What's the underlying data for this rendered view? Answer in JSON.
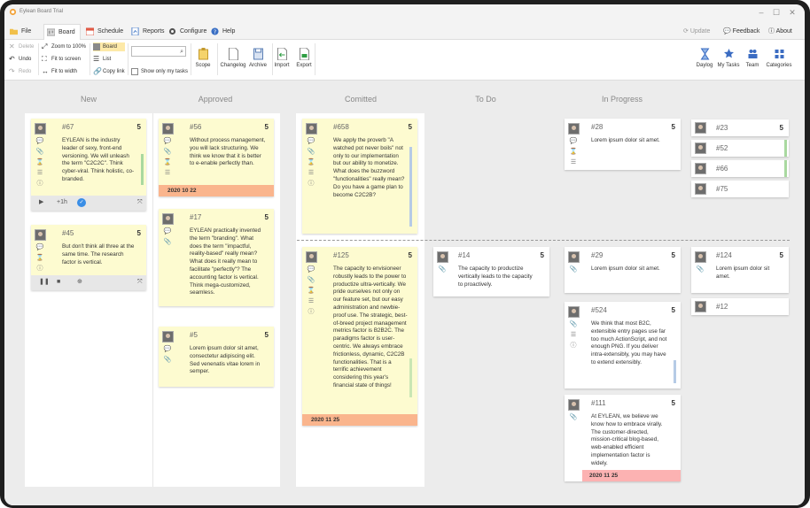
{
  "window": {
    "title": "Eylean Board Trial",
    "controls": {
      "minimize": "–",
      "maximize": "☐",
      "close": "✕"
    }
  },
  "menu": {
    "tabs": [
      {
        "label": "File"
      },
      {
        "label": "Board"
      },
      {
        "label": "Schedule"
      },
      {
        "label": "Reports"
      },
      {
        "label": "Configure"
      },
      {
        "label": "Help"
      }
    ],
    "right": {
      "update": "Update",
      "feedback": "Feedback",
      "about": "About"
    }
  },
  "ribbon": {
    "delete": "Delete",
    "undo": "Undo",
    "redo": "Redo",
    "zoom_100": "Zoom to 100%",
    "fit_screen": "Fit to screen",
    "fit_width": "Fit to width",
    "board": "Board",
    "list": "List",
    "copy_link": "Copy link",
    "search_placeholder": "",
    "show_only_my_tasks": "Show only my tasks",
    "scope": "Scope",
    "changelog": "Changelog",
    "archive": "Archive",
    "import": "Import",
    "export": "Export",
    "daylog": "Daylog",
    "my_tasks": "My Tasks",
    "team": "Team",
    "categories": "Categories"
  },
  "columns": {
    "new": "New",
    "approved": "Approved",
    "comitted": "Comitted",
    "todo": "To Do",
    "in_progress": "In Progress"
  },
  "cards": {
    "c67": {
      "id": "#67",
      "pts": "5",
      "text": "EYLEAN is the industry leader of sexy, front-end versioning. We will unleash the term \"C2C2C\". Think cyber-viral. Think holistic, co-branded.",
      "time": "+1h"
    },
    "c45": {
      "id": "#45",
      "pts": "5",
      "text": "But don't think all three at the same time. The research factor is vertical."
    },
    "c56": {
      "id": "#56",
      "pts": "5",
      "text": "Without process management, you will lack structuring. We think we know that it is better to e-enable perfectly than.",
      "due": "2020 10 22"
    },
    "c17": {
      "id": "#17",
      "pts": "5",
      "text": "EYLEAN practically invented the term \"branding\". What does the term \"impactful, reality-based\" really mean? What does it really mean to facilitate \"perfectly\"? The accounting factor is vertical. Think mega-customized, seamless."
    },
    "c5": {
      "id": "#5",
      "pts": "5",
      "text": "Lorem ipsum dolor sit amet, consectetur adipiscing elit. Sed venenatis vitae lorem in semper."
    },
    "c658": {
      "id": "#658",
      "pts": "5",
      "text": "We apply the proverb \"A watched pot never boils\" not only to our implementation but our ability to monetize. What does the buzzword \"functionalities\" really mean? Do you have a game plan to become C2C2B?"
    },
    "c125": {
      "id": "#125",
      "pts": "5",
      "text": "The capacity to envisioneer robustly leads to the power to productize ultra-vertically. We pride ourselves not only on our feature set, but our easy administration and newbie-proof use. The strategic, best-of-breed project management metrics factor is B2B2C. The paradigms factor is user-centric. We always embrace frictionless, dynamic, C2C2B functionalities. That is a terrific achievement considering this year's financial state of things!",
      "due": "2020 11 25"
    },
    "c14": {
      "id": "#14",
      "pts": "5",
      "text": "The capacity to productize vertically leads to the capacity to proactively."
    },
    "c28": {
      "id": "#28",
      "pts": "5",
      "text": "Lorem ipsum dolor sit amet."
    },
    "c29": {
      "id": "#29",
      "pts": "5",
      "text": "Lorem ipsum dolor sit amet."
    },
    "c524": {
      "id": "#524",
      "pts": "5",
      "text": "We think that most B2C, extensible entry pages use far too much ActionScript, and not enough PNG. If you deliver intra-extensibly, you may have to extend extensibly."
    },
    "c111": {
      "id": "#111",
      "pts": "5",
      "text": "At EYLEAN, we believe we know how to embrace virally. The customer-directed, mission-critical blog-based, web-enabled efficient implementation factor is widely.",
      "due": "2020 11 25"
    },
    "c23": {
      "id": "#23",
      "pts": "5"
    },
    "c52": {
      "id": "#52"
    },
    "c66": {
      "id": "#66"
    },
    "c75": {
      "id": "#75"
    },
    "c124": {
      "id": "#124",
      "pts": "5",
      "text": "Lorem ipsum dolor sit amet."
    },
    "c12": {
      "id": "#12"
    }
  },
  "colors": {
    "sticky_yellow": "#fdfbd0",
    "due_orange": "#fab58d",
    "due_pink": "#fcb2b2",
    "board_bg": "#ececec",
    "accent_blue": "#3a8ee6"
  }
}
